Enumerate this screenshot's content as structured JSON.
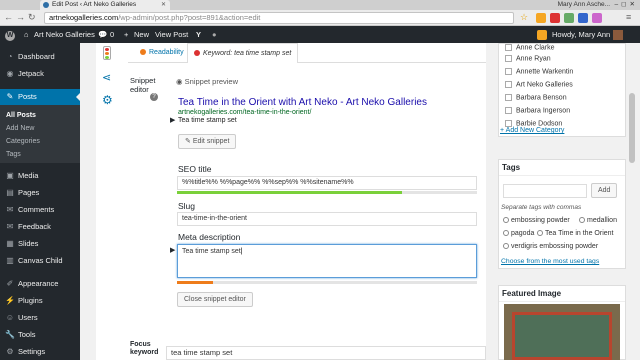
{
  "browser": {
    "tab_title": "Edit Post ‹ Art Neko Galleries",
    "profile_name": "Mary Ann Asche...",
    "url_host": "artnekogalleries.com",
    "url_path": "/wp-admin/post.php?post=891&action=edit"
  },
  "adminbar": {
    "site_name": "Art Neko Galleries",
    "comments_count": "0",
    "new_label": "New",
    "view_post_label": "View Post",
    "howdy": "Howdy, Mary Ann"
  },
  "sidebar": {
    "items": [
      {
        "label": "Dashboard",
        "icon": "dashboard-icon"
      },
      {
        "label": "Jetpack",
        "icon": "jetpack-icon"
      },
      {
        "label": "Posts",
        "icon": "pin-icon"
      },
      {
        "label": "Media",
        "icon": "media-icon"
      },
      {
        "label": "Pages",
        "icon": "pages-icon"
      },
      {
        "label": "Comments",
        "icon": "comments-icon"
      },
      {
        "label": "Feedback",
        "icon": "feedback-icon"
      },
      {
        "label": "Slides",
        "icon": "slides-icon"
      },
      {
        "label": "Canvas Child",
        "icon": "canvas-icon"
      },
      {
        "label": "Appearance",
        "icon": "brush-icon"
      },
      {
        "label": "Plugins",
        "icon": "plug-icon"
      },
      {
        "label": "Users",
        "icon": "users-icon"
      },
      {
        "label": "Tools",
        "icon": "tools-icon"
      },
      {
        "label": "Settings",
        "icon": "settings-icon"
      }
    ],
    "submenu": [
      "All Posts",
      "Add New",
      "Categories",
      "Tags"
    ]
  },
  "seo": {
    "tab_readability": "Readability",
    "tab_keyword": "Keyword: tea time stamp set",
    "snippet_editor_label": "Snippet editor",
    "snippet_preview_label": "Snippet preview",
    "preview_title": "Tea Time in the Orient with Art Neko - Art Neko Galleries",
    "preview_url": "artnekogalleries.com/tea-time-in-the-orient/",
    "preview_desc": "Tea time stamp set",
    "edit_snippet_button": "Edit snippet",
    "seo_title_label": "SEO title",
    "seo_title_value": "%%title%% %%page%% %%sep%% %%sitename%%",
    "seo_title_progress": 0.75,
    "slug_label": "Slug",
    "slug_value": "tea-time-in-the-orient",
    "meta_label": "Meta description",
    "meta_value": "Tea time stamp set",
    "meta_progress": 0.12,
    "close_button": "Close snippet editor",
    "focus_keyword_label": "Focus keyword",
    "focus_keyword_value": "tea time stamp set",
    "colors": {
      "good": "#7ad03a",
      "ok": "#ee7c1b",
      "bad": "#dc3232"
    }
  },
  "categories": {
    "items": [
      "Anne Clarke",
      "Anne Ryan",
      "Annette Warkentin",
      "Art Neko Galleries",
      "Barbara Benson",
      "Barbara Ingerson",
      "Barbie Dodson"
    ],
    "add_new_link": "+ Add New Category"
  },
  "tags": {
    "title": "Tags",
    "add_button": "Add",
    "hint": "Separate tags with commas",
    "items": [
      "embossing powder",
      "medallion",
      "pagoda",
      "Tea Time in the Orient",
      "verdigris embossing powder"
    ],
    "most_used_link": "Choose from the most used tags"
  },
  "featured": {
    "title": "Featured Image"
  }
}
